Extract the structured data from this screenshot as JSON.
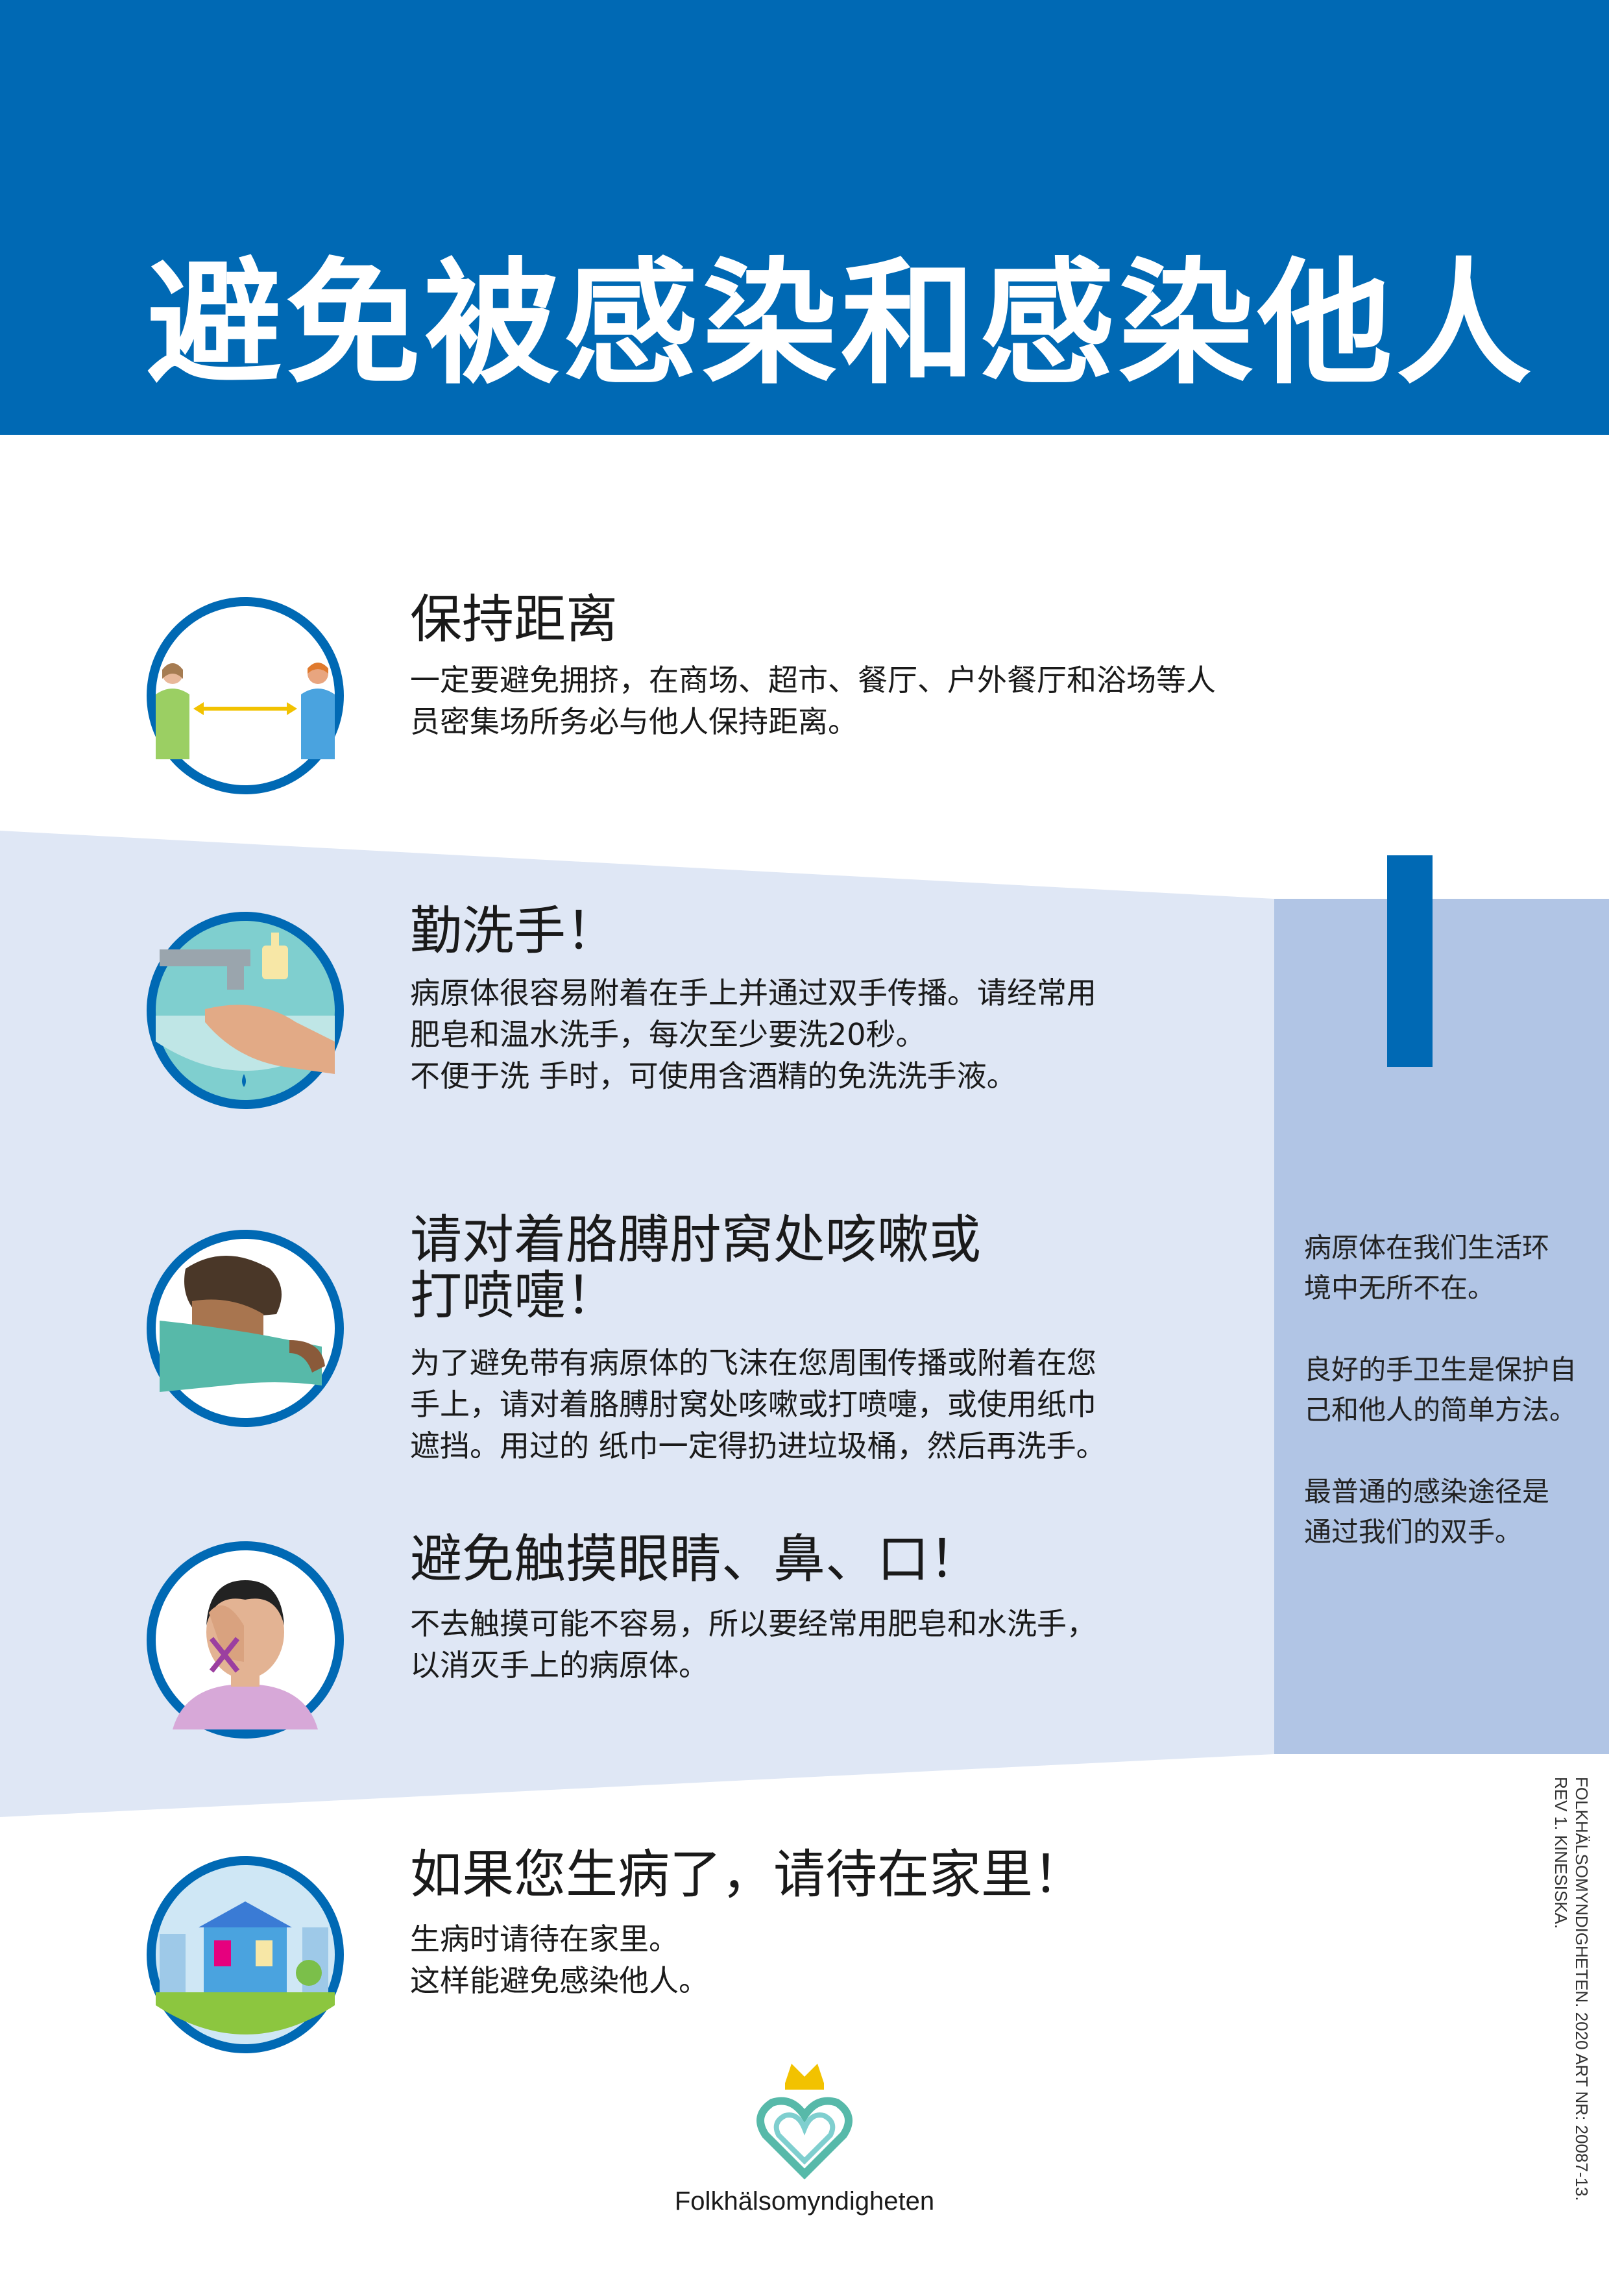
{
  "header": {
    "title": "避免被感染和感染他人"
  },
  "items": [
    {
      "title": "保持距离",
      "body": [
        "一定要避免拥挤，在商场、超市、餐厅、户外餐厅和浴场等人",
        "员密集场所务必与他人保持距离。"
      ],
      "icon": "social-distance-icon"
    },
    {
      "title": "勤洗手！",
      "body": [
        "病原体很容易附着在手上并通过双手传播。请经常用",
        "肥皂和温水洗手，每次至少要洗20秒。",
        "不便于洗 手时，可使用含酒精的免洗洗手液。"
      ],
      "icon": "hand-washing-icon"
    },
    {
      "title": [
        "请对着胳膊肘窝处咳嗽或",
        "打喷嚏！"
      ],
      "body": [
        "为了避免带有病原体的飞沫在您周围传播或附着在您",
        "手上，请对着胳膊肘窝处咳嗽或打喷嚏，或使用纸巾",
        "遮挡。用过的 纸巾一定得扔进垃圾桶，然后再洗手。"
      ],
      "icon": "cough-elbow-icon"
    },
    {
      "title": "避免触摸眼睛、鼻、口！",
      "body": [
        "不去触摸可能不容易，所以要经常用肥皂和水洗手，",
        "以消灭手上的病原体。"
      ],
      "icon": "no-face-touch-icon"
    },
    {
      "title": "如果您生病了，请待在家里！",
      "body": [
        "生病时请待在家里。",
        "这样能避免感染他人。"
      ],
      "icon": "stay-home-icon"
    }
  ],
  "side_panel": {
    "paragraphs": [
      [
        "病原体在我们生活环",
        "境中无所不在。"
      ],
      [
        "良好的手卫生是保护自",
        "己和他人的简单方法。"
      ],
      [
        "最普通的感染途径是",
        "通过我们的双手。"
      ]
    ],
    "mark_icon": "exclamation-icon"
  },
  "credit": [
    "FOLKHÄLSOMYNDIGHETEN. 2020 ART NR: 20087-13.",
    "REV 1. KINESISKA."
  ],
  "logo": {
    "name": "Folkhälsomyndigheten",
    "icon": "crown-heart-logo"
  },
  "colors": {
    "primary_blue": "#0069b4",
    "light_band": "#dfe7f5",
    "side_panel": "#b1c5e5",
    "teal": "#57b9a9"
  }
}
